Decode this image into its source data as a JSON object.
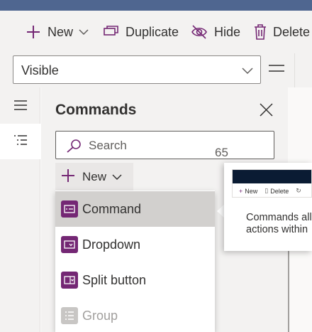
{
  "toolbar": {
    "new_label": "New",
    "duplicate_label": "Duplicate",
    "hide_label": "Hide",
    "delete_label": "Delete"
  },
  "property_bar": {
    "visible_value": "Visible"
  },
  "panel": {
    "title": "Commands",
    "search_placeholder": "Search",
    "new_label": "New",
    "partial_value": "65"
  },
  "new_menu": {
    "items": [
      {
        "label": "Command",
        "icon": "command-icon",
        "state": "hover"
      },
      {
        "label": "Dropdown",
        "icon": "dropdown-icon",
        "state": "normal"
      },
      {
        "label": "Split button",
        "icon": "split-button-icon",
        "state": "normal"
      },
      {
        "label": "Group",
        "icon": "group-icon",
        "state": "disabled"
      }
    ]
  },
  "tooltip": {
    "preview_new": "New",
    "preview_delete": "Delete",
    "description_line1": "Commands all",
    "description_line2": "actions within"
  },
  "colors": {
    "accent": "#742774",
    "top_bar": "#4f6690",
    "tooltip_header": "#0a1b33"
  }
}
